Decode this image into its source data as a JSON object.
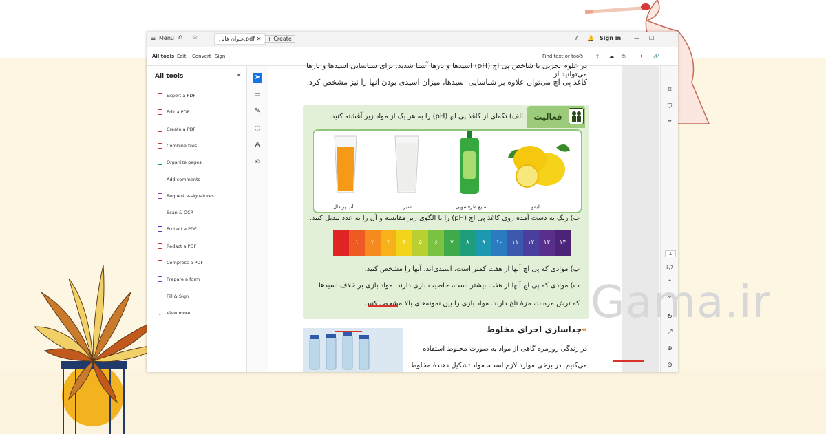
{
  "window": {
    "menu_label": "Menu",
    "tab_title": "عنوان فایل.pdf",
    "new_tab": "+ Create",
    "sign_in": "Sign in"
  },
  "toolbar": {
    "tabs": [
      "All tools",
      "Edit",
      "Convert",
      "Sign"
    ],
    "find": "Find text or tools"
  },
  "sidepanel": {
    "title": "All tools",
    "items": [
      "Export a PDF",
      "Edit a PDF",
      "Create a PDF",
      "Combine files",
      "Organize pages",
      "Add comments",
      "Request e-signatures",
      "Scan & OCR",
      "Protect a PDF",
      "Redact a PDF",
      "Compress a PDF",
      "Prepare a form",
      "Fill & Sign",
      "View more"
    ]
  },
  "document": {
    "top_line_1": "در علوم تجربی با شاخص پی اچ (pH) اسید‌ها و باز‌ها آشنا شدید. برای شناسایی اسیدها و بازها می‌توانید از",
    "top_line_2": "کاغذ پی اچ می‌توان علاوه بر شناسایی اسیدها، میزان اسیدی بودن آنها را نیز مشخص کرد.",
    "activity_label": "فعالیت",
    "q_a": "الف) تکه‌ای از کاغذ پی اچ (pH) را به هر یک از مواد زیر آغشته کنید.",
    "captions": [
      "آب پرتقال",
      "شیر",
      "مایع ظرفشویی",
      "لیمو"
    ],
    "q_b": "ب) رنگ به دست آمده روی کاغذ پی اچ (pH) را با الگوی زیر مقایسه و آن را به عدد تبدیل کنید.",
    "ph_values": [
      "۰",
      "۱",
      "۲",
      "۳",
      "۴",
      "۵",
      "۶",
      "۷",
      "۸",
      "۹",
      "۱۰",
      "۱۱",
      "۱۲",
      "۱۳",
      "۱۴"
    ],
    "q_p": "پ) موادی که پی اچ آنها از هفت کمتر است، اسیدی‌اند. آنها را مشخص کنید.",
    "q_t1": "ت) موادی که پی اچ آنها از هفت بیشتر است، خاصیت بازی دارند. مواد بازی بر خلاف اسیدها",
    "q_t2": "که ترش مزه‌اند، مزهٔ تلخ دارند. مواد بازی را بین نمونه‌های بالا مشخص کنید.",
    "section_title": "جداسازی اجزای مخلوط",
    "body_1": "در زندگی روزمره گاهی از مواد به صورت مخلوط استفاده",
    "body_2": "می‌کنیم. در برخی موارد لازم است، مواد تشکیل دهندهٔ مخلوط"
  },
  "rightrail": {
    "page_num": "1",
    "page_total": "5/7"
  },
  "watermark": "Gama.ir",
  "colors": {
    "ph": [
      "#e02424",
      "#ef5a24",
      "#f58a1f",
      "#f7b21a",
      "#f2d41a",
      "#b9d130",
      "#7cc242",
      "#3eaa4a",
      "#1e9d7a",
      "#1c98b0",
      "#2a7bc2",
      "#3b5aae",
      "#4a3f9c",
      "#5a2f8c",
      "#4b2478"
    ],
    "activity_bg": "#e3f0d8",
    "accent": "#1473e6"
  }
}
